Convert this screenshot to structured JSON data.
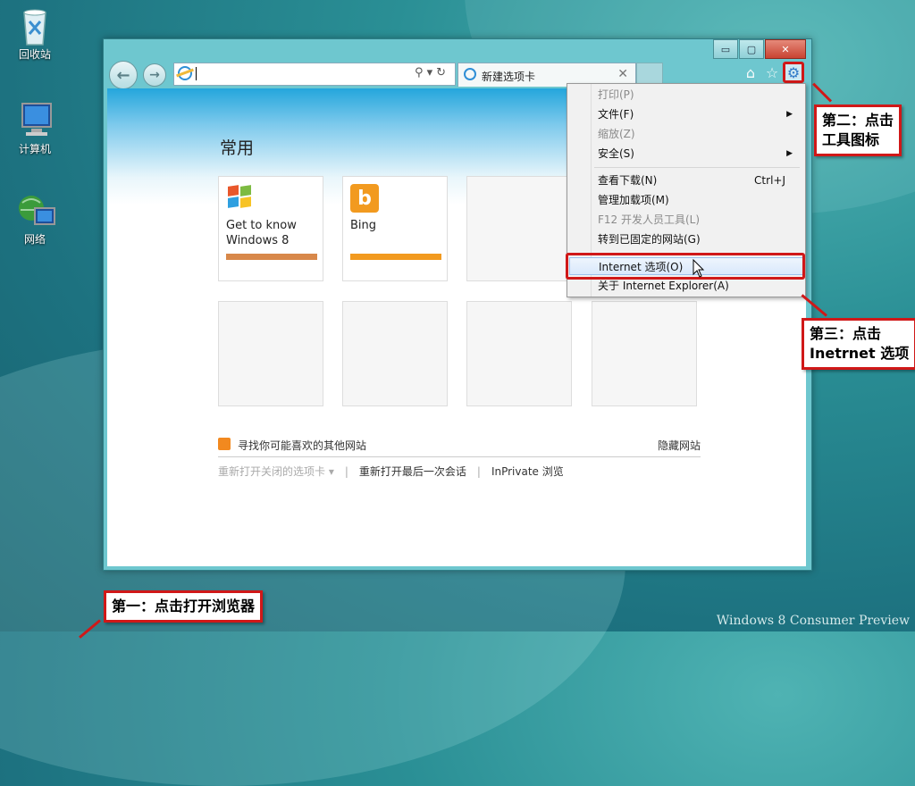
{
  "desktop": {
    "icons": [
      {
        "label": "回收站"
      },
      {
        "label": "计算机"
      },
      {
        "label": "网络"
      }
    ],
    "watermark": "Windows 8 Consumer Preview"
  },
  "browser": {
    "caption": {
      "minimize": "▭",
      "maximize": "▢",
      "close": "✕"
    },
    "address": {
      "value": ""
    },
    "tab": {
      "label": "新建选项卡",
      "close": "✕"
    },
    "section_title": "常用",
    "tiles": [
      {
        "label_line1": "Get to know",
        "label_line2": "Windows 8",
        "bar_color": "#d8884a"
      },
      {
        "label_line1": "Bing",
        "label_line2": "",
        "bar_color": "#f29a1f"
      }
    ],
    "find_sites": "寻找你可能喜欢的其他网站",
    "hide_sites": "隐藏网站",
    "links": {
      "reopen_tabs": "重新打开关闭的选项卡 ▾",
      "reopen_session": "重新打开最后一次会话",
      "inprivate": "InPrivate 浏览"
    }
  },
  "tools_menu": {
    "items": [
      {
        "label": "打印(P)",
        "disabled": true
      },
      {
        "label": "文件(F)",
        "submenu": true
      },
      {
        "label": "缩放(Z)",
        "disabled": true
      },
      {
        "label": "安全(S)",
        "submenu": true
      },
      {
        "label": "查看下载(N)",
        "shortcut": "Ctrl+J"
      },
      {
        "label": "管理加载项(M)"
      },
      {
        "label": "F12 开发人员工具(L)",
        "disabled": true
      },
      {
        "label": "转到已固定的网站(G)"
      },
      {
        "label": "Internet 选项(O)",
        "highlighted": true
      },
      {
        "label": "关于 Internet Explorer(A)"
      }
    ]
  },
  "callouts": {
    "step1": "第一：点击打开浏览器",
    "step2_line1": "第二：点击",
    "step2_line2": "工具图标",
    "step3_line1": "第三：点击",
    "step3_line2": "Inetrnet 选项"
  },
  "colors": {
    "annotation_red": "#d01818",
    "menu_highlight": "#d9e8fb"
  }
}
